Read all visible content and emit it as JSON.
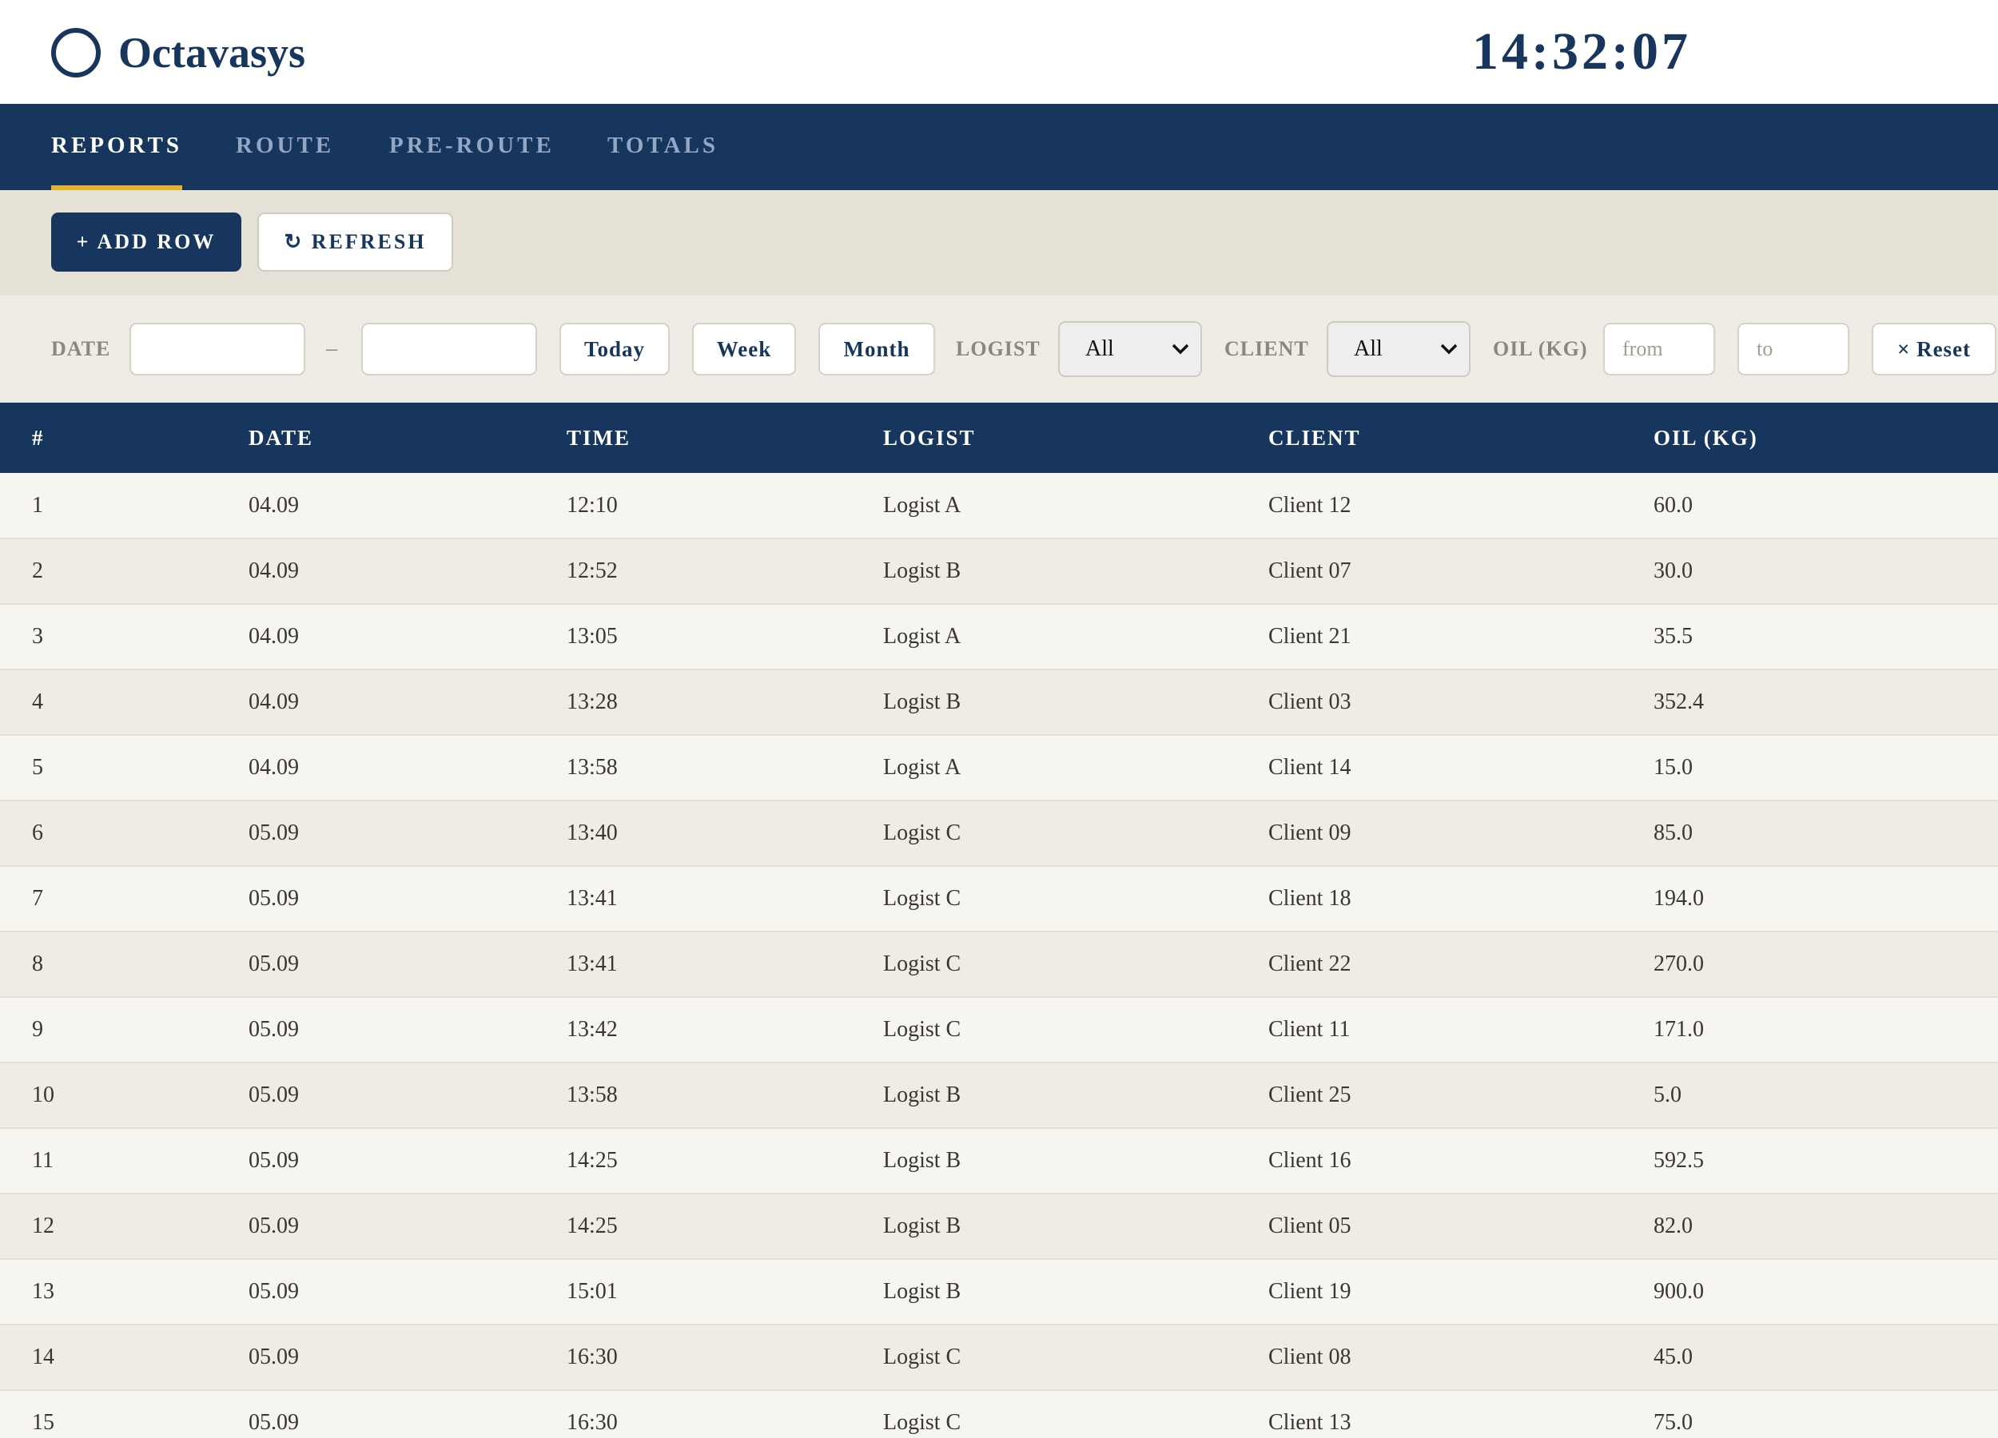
{
  "app": {
    "name": "Octavasys",
    "clock": "14:32:07"
  },
  "nav": {
    "tabs": [
      {
        "label": "REPORTS",
        "active": true
      },
      {
        "label": "ROUTE",
        "active": false
      },
      {
        "label": "PRE-ROUTE",
        "active": false
      },
      {
        "label": "TOTALS",
        "active": false
      }
    ]
  },
  "toolbar": {
    "add_row_label": "+ ADD ROW",
    "refresh_label": "↻ REFRESH"
  },
  "filters": {
    "date_label": "DATE",
    "date_from_value": "",
    "date_to_value": "",
    "range_separator": "–",
    "today_label": "Today",
    "week_label": "Week",
    "month_label": "Month",
    "logist_label": "LOGIST",
    "logist_value": "All",
    "client_label": "CLIENT",
    "client_value": "All",
    "oil_label": "OIL (KG)",
    "oil_from_placeholder": "from",
    "oil_to_placeholder": "to",
    "reset_label": "× Reset"
  },
  "table": {
    "columns": [
      "#",
      "DATE",
      "TIME",
      "LOGIST",
      "CLIENT",
      "OIL (KG)"
    ],
    "rows": [
      [
        "1",
        "04.09",
        "12:10",
        "Logist A",
        "Client 12",
        "60.0"
      ],
      [
        "2",
        "04.09",
        "12:52",
        "Logist B",
        "Client 07",
        "30.0"
      ],
      [
        "3",
        "04.09",
        "13:05",
        "Logist A",
        "Client 21",
        "35.5"
      ],
      [
        "4",
        "04.09",
        "13:28",
        "Logist B",
        "Client 03",
        "352.4"
      ],
      [
        "5",
        "04.09",
        "13:58",
        "Logist A",
        "Client 14",
        "15.0"
      ],
      [
        "6",
        "05.09",
        "13:40",
        "Logist C",
        "Client 09",
        "85.0"
      ],
      [
        "7",
        "05.09",
        "13:41",
        "Logist C",
        "Client 18",
        "194.0"
      ],
      [
        "8",
        "05.09",
        "13:41",
        "Logist C",
        "Client 22",
        "270.0"
      ],
      [
        "9",
        "05.09",
        "13:42",
        "Logist C",
        "Client 11",
        "171.0"
      ],
      [
        "10",
        "05.09",
        "13:58",
        "Logist B",
        "Client 25",
        "5.0"
      ],
      [
        "11",
        "05.09",
        "14:25",
        "Logist B",
        "Client 16",
        "592.5"
      ],
      [
        "12",
        "05.09",
        "14:25",
        "Logist B",
        "Client 05",
        "82.0"
      ],
      [
        "13",
        "05.09",
        "15:01",
        "Logist B",
        "Client 19",
        "900.0"
      ],
      [
        "14",
        "05.09",
        "16:30",
        "Logist C",
        "Client 08",
        "45.0"
      ],
      [
        "15",
        "05.09",
        "16:30",
        "Logist C",
        "Client 13",
        "75.0"
      ]
    ]
  }
}
